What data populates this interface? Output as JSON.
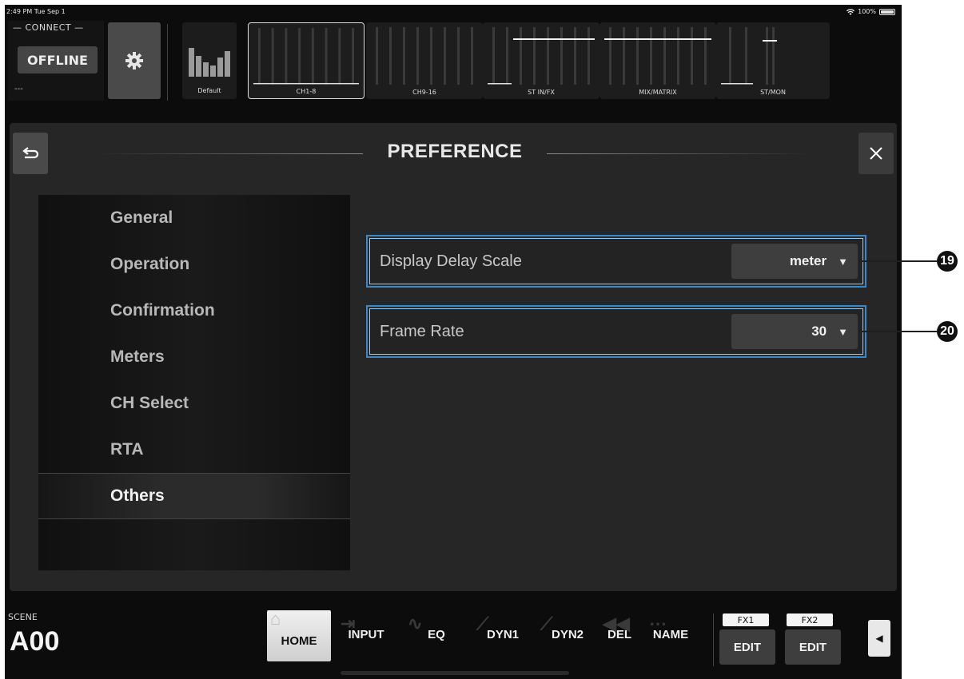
{
  "status": {
    "time": "2:49 PM  Tue Sep 1",
    "battery": "100%"
  },
  "connect": {
    "label": "— CONNECT —",
    "button": "OFFLINE",
    "info": "---"
  },
  "top": {
    "default_label": "Default",
    "banks": [
      {
        "label": "CH1-8",
        "selected": true
      },
      {
        "label": "CH9-16",
        "selected": false
      },
      {
        "label": "ST IN/FX",
        "selected": false
      },
      {
        "label": "MIX/MATRIX",
        "selected": false
      },
      {
        "label": "ST/MON",
        "selected": false
      }
    ]
  },
  "preference": {
    "title": "PREFERENCE",
    "menu": [
      {
        "label": "General",
        "active": false
      },
      {
        "label": "Operation",
        "active": false
      },
      {
        "label": "Confirmation",
        "active": false
      },
      {
        "label": "Meters",
        "active": false
      },
      {
        "label": "CH Select",
        "active": false
      },
      {
        "label": "RTA",
        "active": false
      },
      {
        "label": "Others",
        "active": true
      }
    ],
    "settings": [
      {
        "label": "Display Delay Scale",
        "value": "meter",
        "callout": "19"
      },
      {
        "label": "Frame Rate",
        "value": "30",
        "callout": "20"
      }
    ]
  },
  "bottom": {
    "scene_label": "SCENE",
    "scene_value": "A00",
    "tabs": [
      "HOME",
      "INPUT",
      "EQ",
      "DYN1",
      "DYN2",
      "DEL",
      "NAME"
    ],
    "fx": [
      {
        "label": "FX1",
        "button": "EDIT"
      },
      {
        "label": "FX2",
        "button": "EDIT"
      }
    ]
  },
  "colors": {
    "highlight_border": "#3a88c8",
    "panel": "#262626",
    "background": "#0c0c0c"
  }
}
